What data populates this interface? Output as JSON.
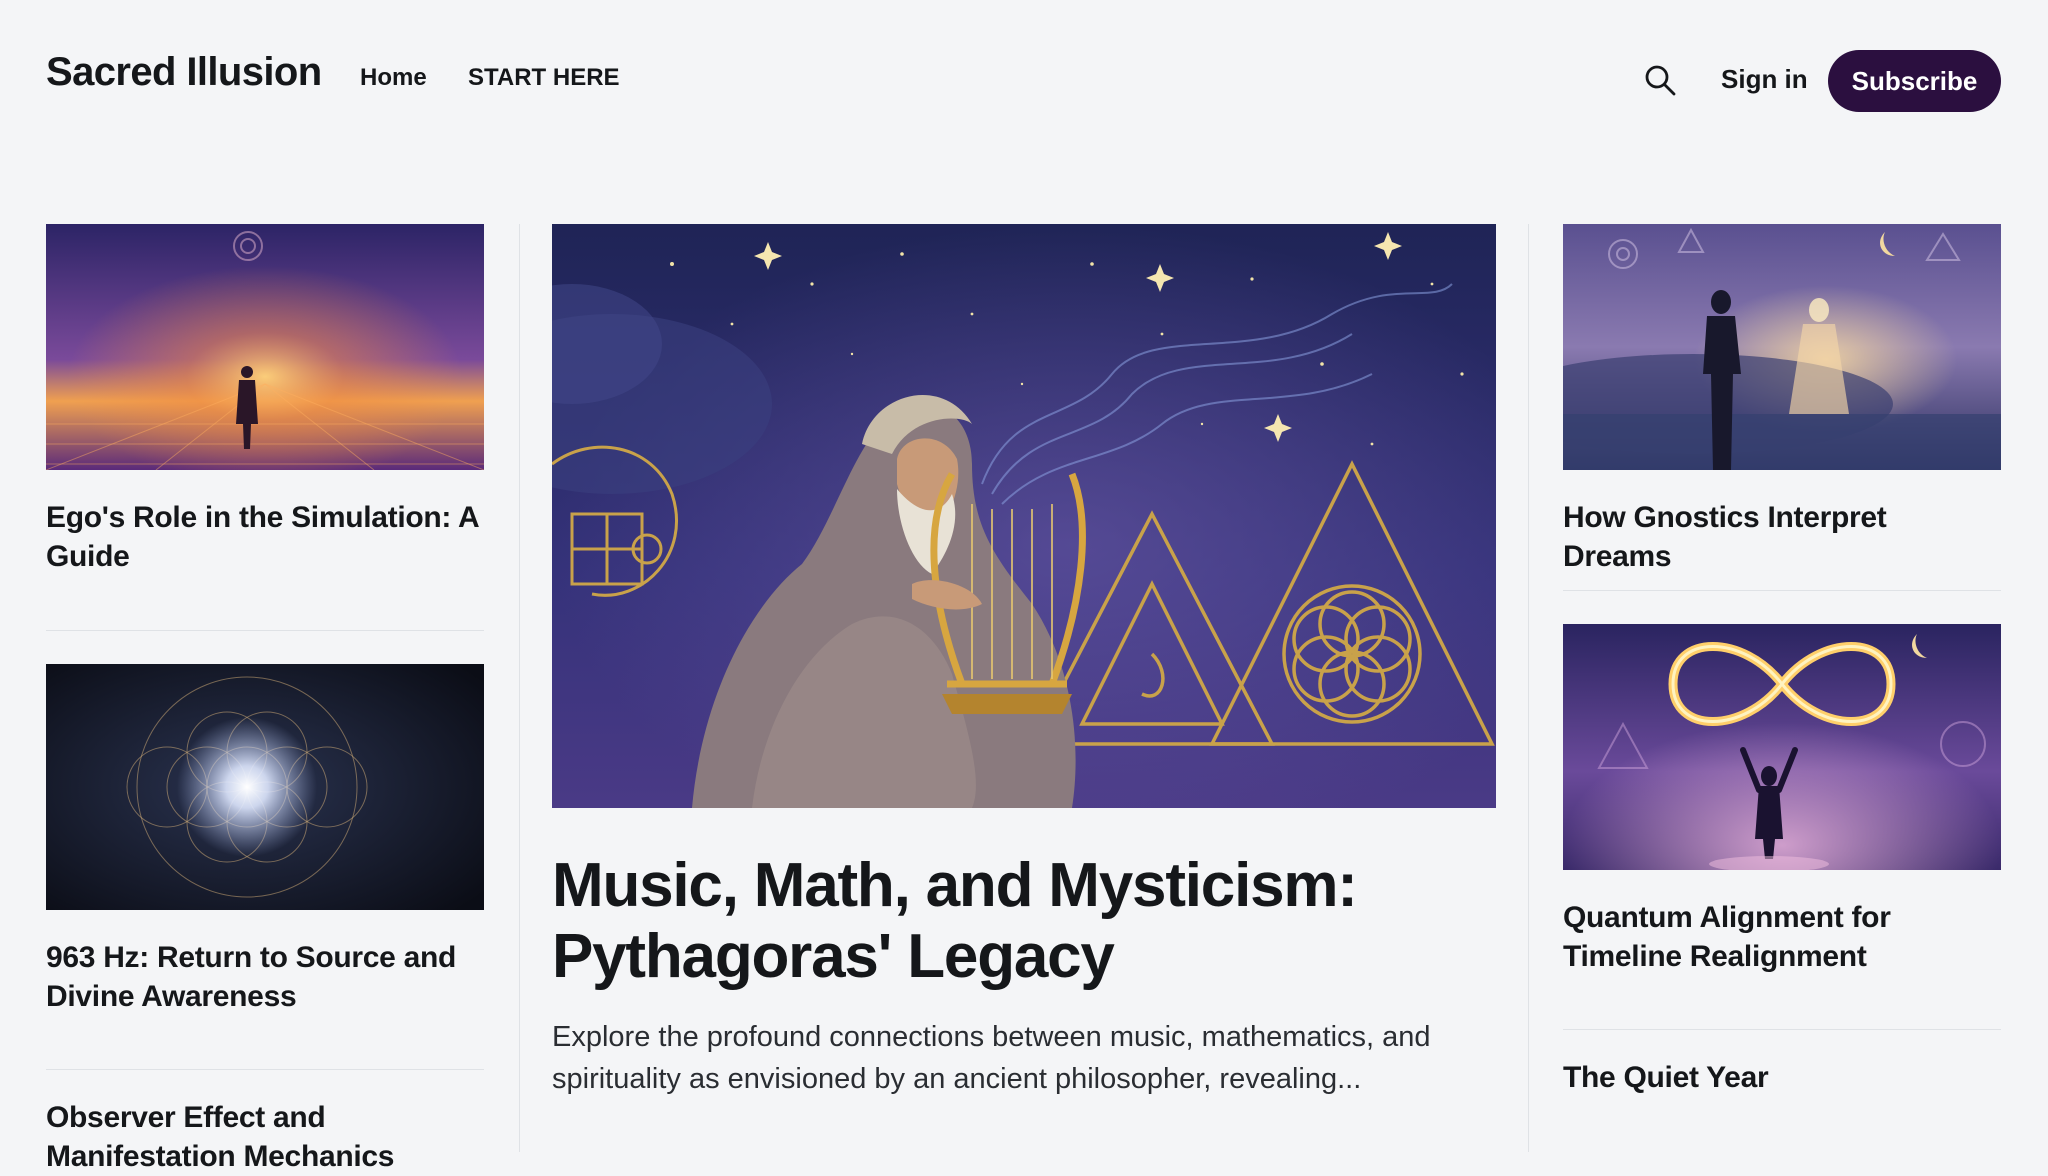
{
  "site": {
    "name": "Sacred Illusion"
  },
  "nav": {
    "items": [
      {
        "label": "Home"
      },
      {
        "label": "START HERE"
      }
    ]
  },
  "header_actions": {
    "search_icon": "search-icon",
    "signin_label": "Sign in",
    "subscribe_label": "Subscribe"
  },
  "colors": {
    "background": "#f4f5f7",
    "text": "#15171a",
    "subscribe_bg": "#2b0f3f",
    "subscribe_text": "#ffffff",
    "divider": "#dfe2e6"
  },
  "feature": {
    "title": "Music, Math, and Mysticism: Pythagoras' Legacy",
    "excerpt": "Explore the profound connections between music, mathematics, and spirituality as envisioned by an ancient philosopher, revealing..."
  },
  "left_column": [
    {
      "title": "Ego's Role in the Simulation: A Guide"
    },
    {
      "title": "963 Hz: Return to Source and Divine Awareness"
    },
    {
      "title": "Observer Effect and Manifestation Mechanics"
    }
  ],
  "right_column": [
    {
      "title": "How Gnostics Interpret Dreams"
    },
    {
      "title": "Quantum Alignment for Timeline Realignment"
    },
    {
      "title": "The Quiet Year"
    }
  ]
}
